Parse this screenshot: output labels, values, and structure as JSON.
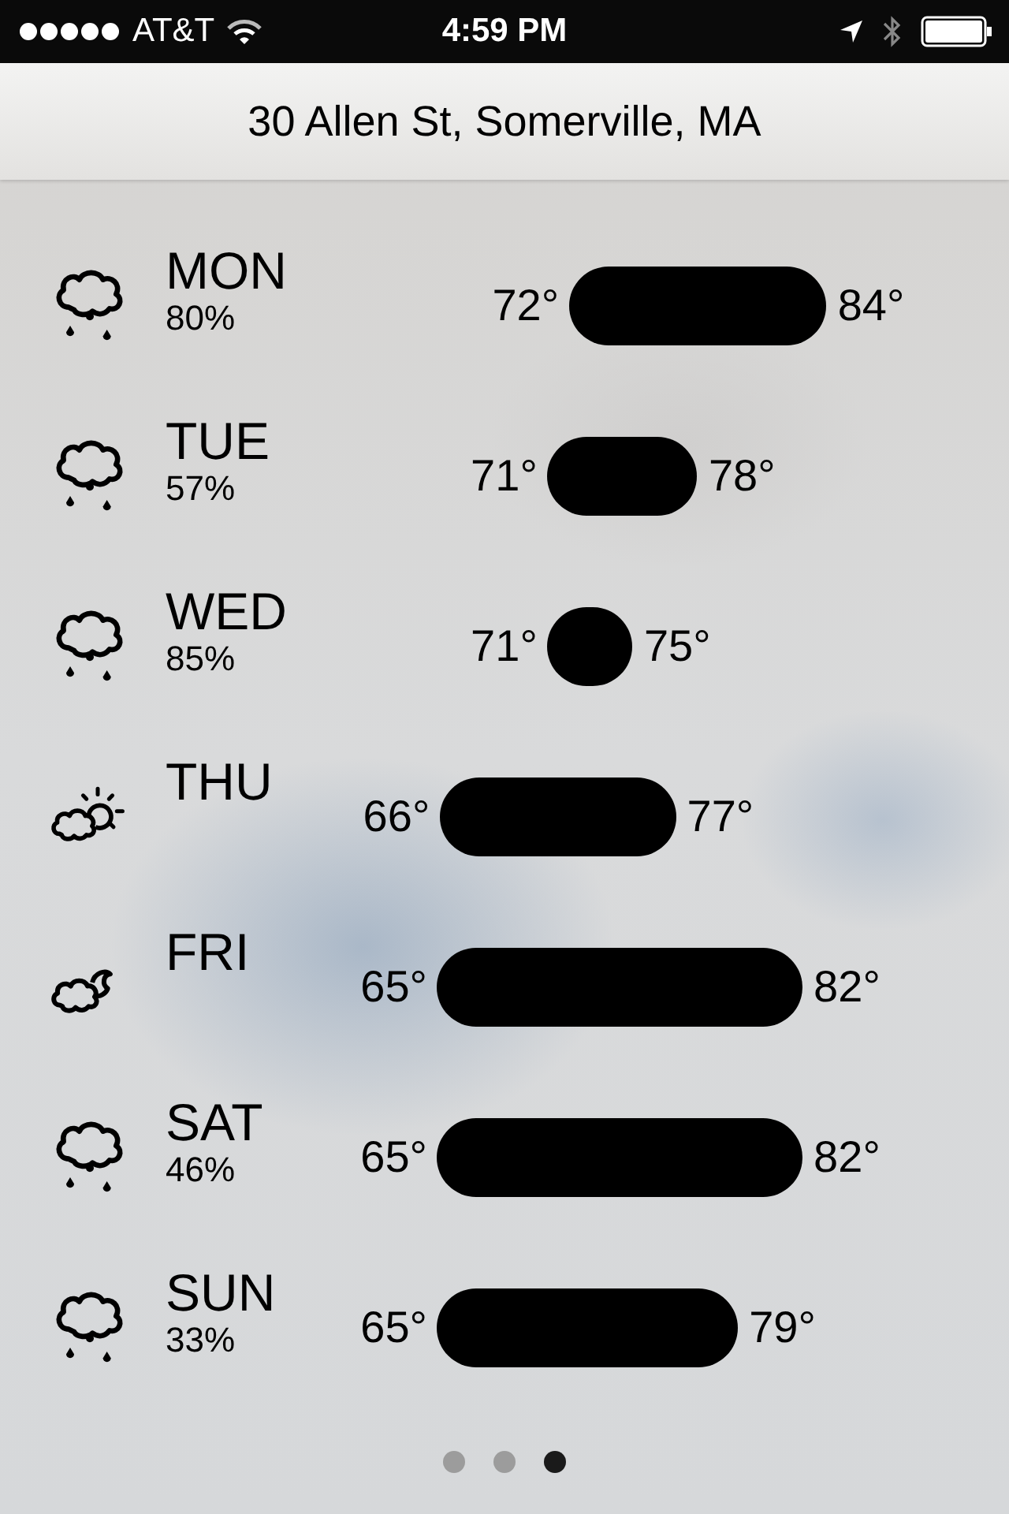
{
  "status_bar": {
    "carrier": "AT&T",
    "time": "4:59 PM"
  },
  "location": "30 Allen St, Somerville, MA",
  "days": [
    {
      "day": "MON",
      "kind": "rain",
      "chance": "80%",
      "low": "72°",
      "high": "84°"
    },
    {
      "day": "TUE",
      "kind": "rain",
      "chance": "57%",
      "low": "71°",
      "high": "78°"
    },
    {
      "day": "WED",
      "kind": "rain",
      "chance": "85%",
      "low": "71°",
      "high": "75°"
    },
    {
      "day": "THU",
      "kind": "partly-sunny",
      "low": "66°",
      "high": "77°"
    },
    {
      "day": "FRI",
      "kind": "partly-moon",
      "low": "65°",
      "high": "82°"
    },
    {
      "day": "SAT",
      "kind": "rain",
      "chance": "46%",
      "low": "65°",
      "high": "82°"
    },
    {
      "day": "SUN",
      "kind": "rain",
      "chance": "33%",
      "low": "65°",
      "high": "79°"
    }
  ],
  "pages": [
    {
      "selected": false
    },
    {
      "selected": false
    },
    {
      "selected": true
    }
  ]
}
